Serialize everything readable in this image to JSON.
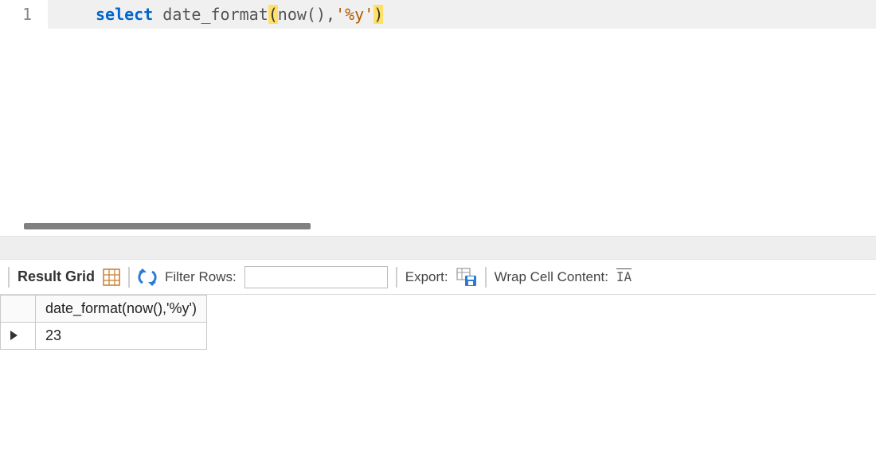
{
  "editor": {
    "line_number": "1",
    "tokens": {
      "select": "select",
      "space1": " ",
      "fn": "date_format",
      "lparen": "(",
      "now": "now",
      "lparen2": "(",
      "rparen2": ")",
      "comma": ",",
      "q1": "'",
      "fmt": "%y",
      "q2": "'",
      "rparen": ")"
    }
  },
  "toolbar": {
    "result_grid": "Result Grid",
    "filter_label": "Filter Rows:",
    "filter_value": "",
    "export_label": "Export:",
    "wrap_label": "Wrap Cell Content:",
    "wrap_icon_text": "IA"
  },
  "result": {
    "header": "date_format(now(),'%y')",
    "rows": [
      {
        "value": "23"
      }
    ]
  }
}
